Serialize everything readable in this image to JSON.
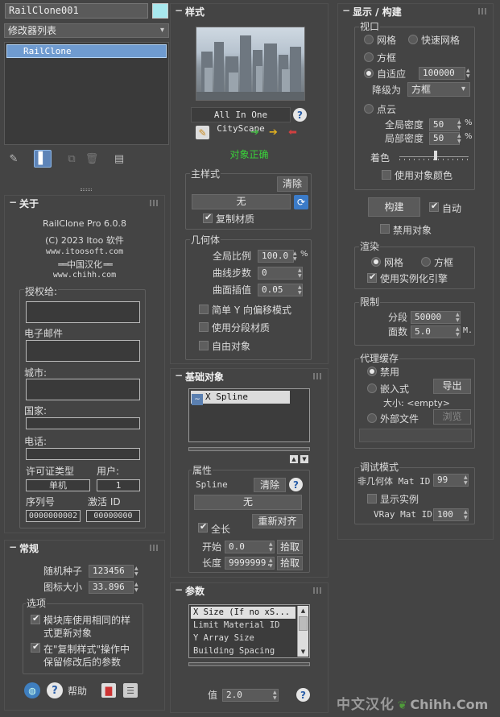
{
  "left": {
    "object_name": "RailClone001",
    "modifier_list": "修改器列表",
    "stack_item": "RailClone",
    "about": {
      "title": "关于",
      "product": "RailClone Pro 6.0.8",
      "copyright": "(C) 2023 Itoo 软件",
      "website": "www.itoosoft.com",
      "localization": "中国汉化",
      "chinese_site": "www.chihh.com",
      "licensed_to": "授权给:",
      "email": "电子邮件",
      "city": "城市:",
      "country": "国家:",
      "phone": "电话:",
      "license_type": "许可证类型",
      "users": "用户:",
      "license_value": "单机",
      "users_value": "1",
      "serial": "序列号",
      "activation": "激活 ID",
      "serial_value": "0000000002",
      "activation_value": "00000000"
    },
    "general": {
      "title": "常规",
      "seed_label": "随机种子",
      "seed_value": "123456",
      "icon_size_label": "图标大小",
      "icon_size_value": "33.896",
      "options": "选项",
      "opt1_line1": "模块库使用相同的样",
      "opt1_line2": "式更新对象",
      "opt2_line1": "在\"复制样式\"操作中",
      "opt2_line2": "保留修改后的参数",
      "help": "帮助"
    }
  },
  "style": {
    "title": "样式",
    "style_name": "All In One CityScape",
    "status": "对象正确",
    "main_style": "主样式",
    "clear": "清除",
    "none": "无",
    "copy_material": "复制材质",
    "geometry": "几何体",
    "global_scale_label": "全局比例",
    "global_scale_value": "100.0",
    "percent": "%",
    "curve_steps_label": "曲线步数",
    "curve_steps_value": "0",
    "surface_interp_label": "曲面插值",
    "surface_interp_value": "0.05",
    "simple_y": "简单 Y 向偏移模式",
    "segment_mat": "使用分段材质",
    "free_obj": "自由对象"
  },
  "base": {
    "title": "基础对象",
    "item": "X Spline",
    "properties": "属性",
    "spline": "Spline",
    "clear": "清除",
    "none": "无",
    "full_length": "全长",
    "realign": "重新对齐",
    "start_label": "开始",
    "start_value": "0.0",
    "pick": "拾取",
    "length_label": "长度",
    "length_value": "9999999."
  },
  "params": {
    "title": "参数",
    "items": [
      "X Size (If no xS...",
      "Limit Material ID",
      "Y Array Size",
      "Building Spacing"
    ],
    "value_label": "值",
    "value": "2.0"
  },
  "display": {
    "title": "显示 / 构建",
    "viewport": "视口",
    "mesh": "网格",
    "fast_mesh": "快速网格",
    "box": "方框",
    "adaptive": "自适应",
    "adaptive_value": "100000",
    "downgrade": "降级为",
    "downgrade_value": "方框",
    "point_cloud": "点云",
    "global_density": "全局密度",
    "global_density_value": "50",
    "local_density": "局部密度",
    "local_density_value": "50",
    "percent": "%",
    "color": "着色",
    "use_obj_color": "使用对象颜色",
    "build": "构建",
    "auto": "自动",
    "disable_obj": "禁用对象",
    "render": "渲染",
    "r_mesh": "网格",
    "r_box": "方框",
    "use_instancing": "使用实例化引擎",
    "limits": "限制",
    "segments_label": "分段",
    "segments_value": "50000",
    "faces_label": "面数",
    "faces_value": "5.0",
    "faces_unit": "M.",
    "proxy": "代理缓存",
    "disabled": "禁用",
    "embedded": "嵌入式",
    "export": "导出",
    "size": "大小: <empty>",
    "external": "外部文件",
    "browse": "浏览",
    "debug": "调试模式",
    "non_geo_label": "非几何体 Mat ID",
    "non_geo_value": "99",
    "show_instances": "显示实例",
    "vray_label": "VRay Mat ID",
    "vray_value": "100"
  },
  "watermark": {
    "cn": "中文汉化",
    "site": "Chihh.Com"
  },
  "colors": {
    "background": "#444444",
    "accent_green": "#39d139",
    "selection_blue": "#8fb8e6",
    "color_swatch": "#a8e8ee"
  }
}
